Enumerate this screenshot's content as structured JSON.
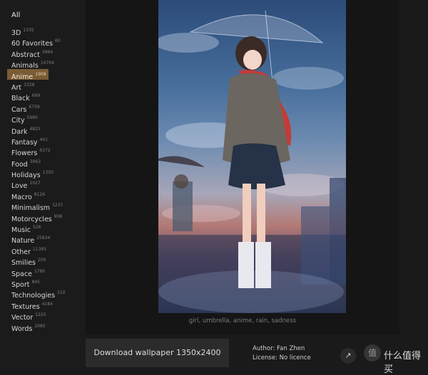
{
  "sidebar": {
    "all_label": "All",
    "categories": [
      {
        "name": "3D",
        "count": "1335"
      },
      {
        "name": "60 Favorites",
        "count": "60"
      },
      {
        "name": "Abstract",
        "count": "3964"
      },
      {
        "name": "Animals",
        "count": "14704"
      },
      {
        "name": "Anime",
        "count": "1908"
      },
      {
        "name": "Art",
        "count": "3328"
      },
      {
        "name": "Black",
        "count": "669"
      },
      {
        "name": "Cars",
        "count": "6759"
      },
      {
        "name": "City",
        "count": "5980"
      },
      {
        "name": "Dark",
        "count": "4825"
      },
      {
        "name": "Fantasy",
        "count": "401"
      },
      {
        "name": "Flowers",
        "count": "6372"
      },
      {
        "name": "Food",
        "count": "3963"
      },
      {
        "name": "Holidays",
        "count": "1350"
      },
      {
        "name": "Love",
        "count": "1027"
      },
      {
        "name": "Macro",
        "count": "8126"
      },
      {
        "name": "Minimalism",
        "count": "1237"
      },
      {
        "name": "Motorcycles",
        "count": "908"
      },
      {
        "name": "Music",
        "count": "526"
      },
      {
        "name": "Nature",
        "count": "25834"
      },
      {
        "name": "Other",
        "count": "11395"
      },
      {
        "name": "Smilies",
        "count": "200"
      },
      {
        "name": "Space",
        "count": "1780"
      },
      {
        "name": "Sport",
        "count": "845"
      },
      {
        "name": "Technologies",
        "count": "310"
      },
      {
        "name": "Textures",
        "count": "4184"
      },
      {
        "name": "Vector",
        "count": "1225"
      },
      {
        "name": "Words",
        "count": "2085"
      }
    ],
    "active_category": "Anime"
  },
  "image": {
    "tags": "girl, umbrella, anime, rain, sadness"
  },
  "download": {
    "label": "Download wallpaper 1350x2400"
  },
  "meta": {
    "author": "Author: Fan Zhen",
    "license": "License: No licence"
  },
  "watermark": {
    "icon_glyph": "值",
    "text": "什么值得买"
  },
  "icons": {
    "share": "share-icon"
  }
}
